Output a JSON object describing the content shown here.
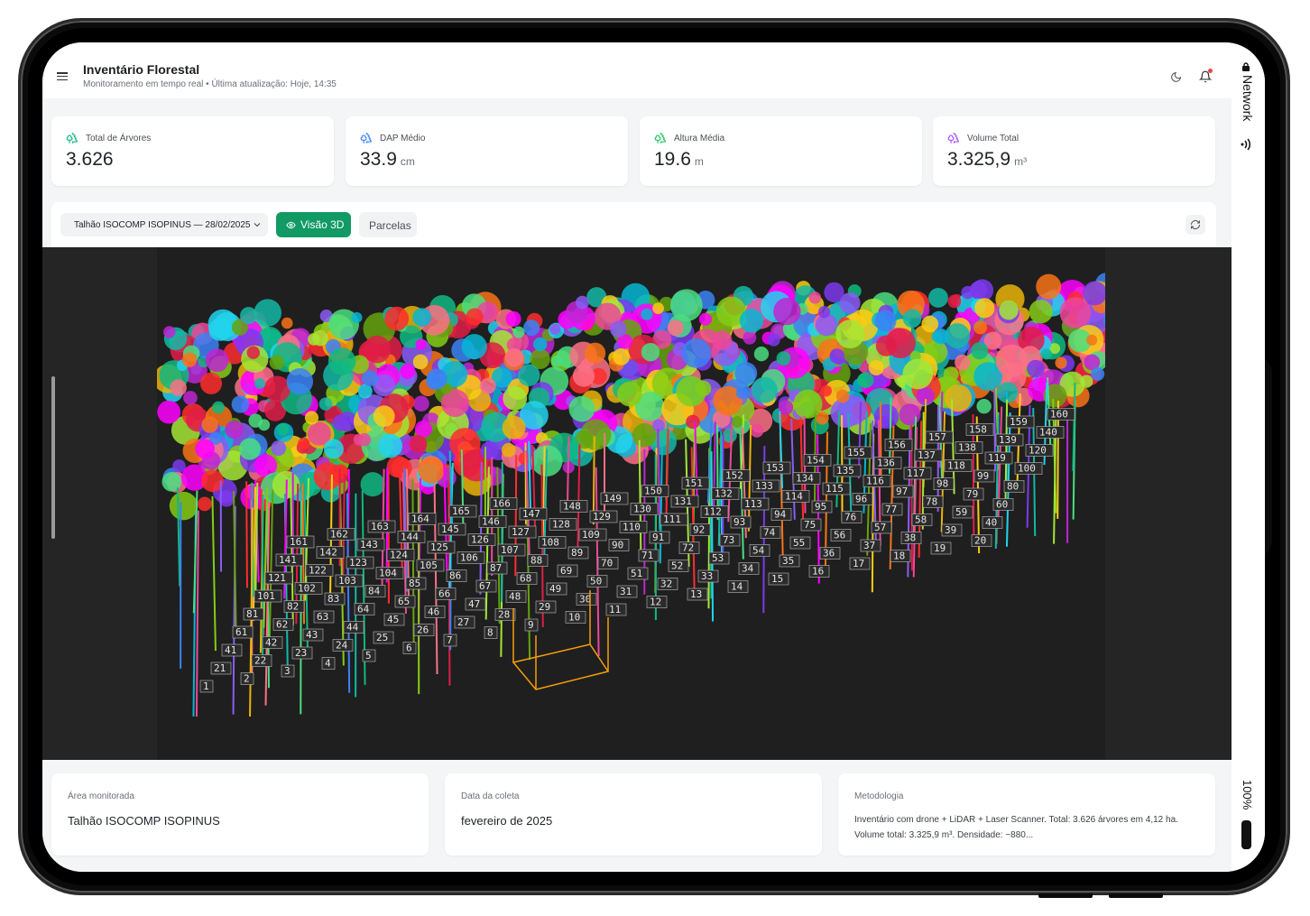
{
  "header": {
    "title": "Inventário Florestal",
    "subtitle": "Monitoramento em tempo real • Última atualização: Hoje, 14:35",
    "icons": [
      "menu-icon",
      "moon-icon",
      "bell-icon"
    ]
  },
  "status": {
    "network": "Network",
    "battery": "100%"
  },
  "stats": [
    {
      "label": "Total de Árvores",
      "value": "3.626",
      "unit": "",
      "color": "#10b981"
    },
    {
      "label": "DAP Médio",
      "value": "33.9",
      "unit": "cm",
      "color": "#3b82f6"
    },
    {
      "label": "Altura Média",
      "value": "19.6",
      "unit": "m",
      "color": "#22c55e"
    },
    {
      "label": "Volume Total",
      "value": "3.325,9",
      "unit": "m³",
      "color": "#a855f7"
    }
  ],
  "toolbar": {
    "select_value": "Talhão ISOCOMP ISOPINUS — 28/02/2025",
    "view3d_label": "Visão 3D",
    "plots_label": "Parcelas",
    "accent": "#119a63"
  },
  "viewer": {
    "tree_labels": [
      "1",
      "2",
      "3",
      "4",
      "5",
      "6",
      "7",
      "8",
      "9",
      "10",
      "11",
      "12",
      "13",
      "14",
      "15",
      "16",
      "17",
      "18",
      "19",
      "20",
      "21",
      "22",
      "23",
      "24",
      "25",
      "26",
      "27",
      "28",
      "29",
      "30",
      "31",
      "32",
      "33",
      "34",
      "35",
      "36",
      "37",
      "38",
      "39",
      "40",
      "41",
      "42",
      "43",
      "44",
      "45",
      "46",
      "47",
      "48",
      "49",
      "50",
      "51",
      "52",
      "53",
      "54",
      "55",
      "56",
      "57",
      "58",
      "59",
      "60",
      "61",
      "62",
      "63",
      "64",
      "65",
      "66",
      "67",
      "68",
      "69",
      "70",
      "71",
      "72",
      "73",
      "74",
      "75",
      "76",
      "77",
      "78",
      "79",
      "80",
      "81",
      "82",
      "83",
      "84",
      "85",
      "86",
      "87",
      "88",
      "89",
      "90",
      "91",
      "92",
      "93",
      "94",
      "95",
      "96",
      "97",
      "98",
      "99",
      "100",
      "101",
      "102",
      "103",
      "104",
      "105",
      "106",
      "107",
      "108",
      "109",
      "110",
      "111",
      "112",
      "113",
      "114",
      "115",
      "116",
      "117",
      "118",
      "119",
      "120",
      "121",
      "122",
      "123",
      "124",
      "125",
      "126",
      "127",
      "128",
      "129",
      "130",
      "131",
      "132",
      "133",
      "134",
      "135",
      "136",
      "137",
      "138",
      "139",
      "140",
      "141",
      "142",
      "143",
      "144",
      "145",
      "146",
      "147",
      "148",
      "149",
      "150",
      "151",
      "152",
      "153",
      "154",
      "155",
      "156",
      "157",
      "158",
      "159",
      "160",
      "161",
      "162",
      "163",
      "164",
      "165",
      "166"
    ]
  },
  "info": {
    "area_label": "Área monitorada",
    "area_value": "Talhão ISOCOMP ISOPINUS",
    "date_label": "Data da coleta",
    "date_value": "fevereiro de 2025",
    "method_label": "Metodologia",
    "method_value": "Inventário com drone + LiDAR + Laser Scanner. Total: 3.626 árvores em 4,12 ha. Volume total: 3.325,9 m³. Densidade: ~880..."
  }
}
